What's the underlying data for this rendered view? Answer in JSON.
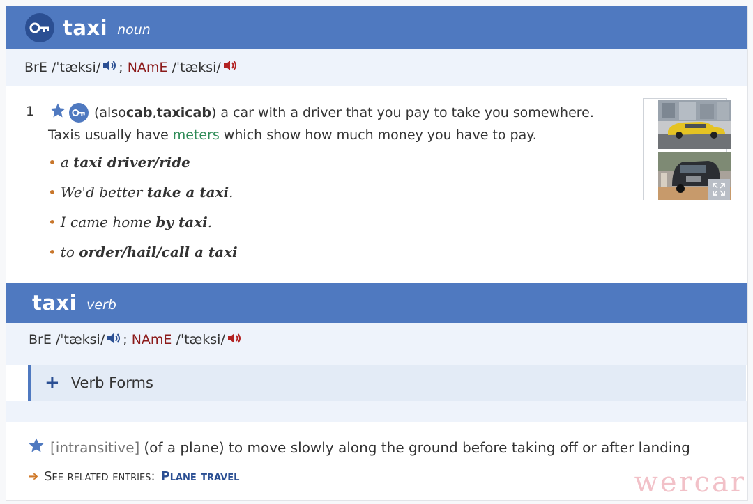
{
  "noun": {
    "headword": "taxi",
    "pos": "noun",
    "pron": {
      "bre_label": "BrE",
      "bre_ipa": "/ˈtæksi/",
      "sep": ";",
      "name_label": "NAmE",
      "name_ipa": "/ˈtæksi/"
    },
    "sense": {
      "number": "1",
      "also_open": "(also ",
      "also_word1": "cab",
      "also_comma": ", ",
      "also_word2": "taxicab",
      "definition": ") a car with a driver that you pay to take you somewhere.",
      "line2_before": "Taxis usually have ",
      "line2_link": "meters",
      "line2_after": " which show how much money you have to pay.",
      "examples": [
        {
          "pre": "a ",
          "bold": "taxi driver/ride",
          "post": ""
        },
        {
          "pre": "We'd better ",
          "bold": "take a taxi",
          "post": "."
        },
        {
          "pre": "I came home ",
          "bold": "by taxi",
          "post": "."
        },
        {
          "pre": "to ",
          "bold": "order/hail/call a taxi",
          "post": ""
        }
      ]
    }
  },
  "verb": {
    "headword": "taxi",
    "pos": "verb",
    "pron": {
      "bre_label": "BrE",
      "bre_ipa": "/ˈtæksi/",
      "sep": ";",
      "name_label": "NAmE",
      "name_ipa": "/ˈtæksi/"
    },
    "verb_forms_label": "Verb Forms",
    "grammar": "[intransitive]",
    "definition": "(of a plane) to move slowly along the ground before taking off or after landing",
    "see_related_label": "See related entries:",
    "related_link": "Plane travel"
  },
  "watermark": "wercar",
  "colors": {
    "header_blue": "#4f79c0",
    "dark_blue": "#2b4f93",
    "name_red": "#8b1a1a",
    "link_green": "#2e8b57",
    "bullet_orange": "#c8762b"
  }
}
